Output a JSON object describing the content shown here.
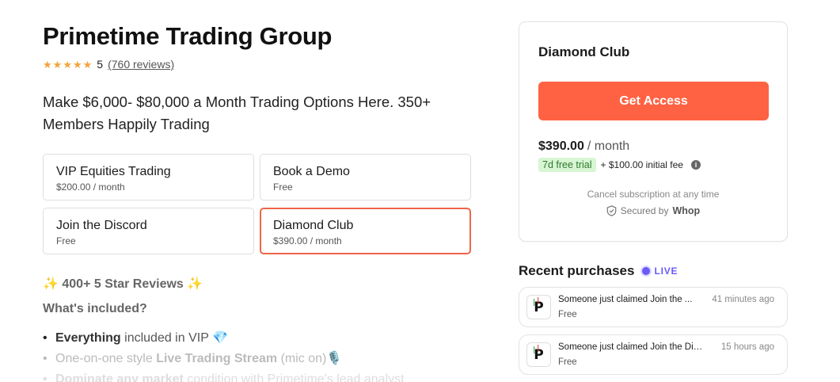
{
  "header": {
    "title": "Primetime Trading Group",
    "rating_value": "5",
    "reviews_link": "(760 reviews)",
    "star_count": 5,
    "tagline": "Make $6,000- $80,000 a Month Trading Options Here. 350+ Members Happily Trading"
  },
  "plans": [
    {
      "name": "VIP Equities Trading",
      "price": "$200.00 / month"
    },
    {
      "name": "Book a Demo",
      "price": "Free"
    },
    {
      "name": "Join the Discord",
      "price": "Free"
    },
    {
      "name": "Diamond Club",
      "price": "$390.00 / month"
    }
  ],
  "selected_plan": "Diamond Club",
  "description": {
    "highlight": "✨ 400+ 5 Star Reviews ✨",
    "included_title": "What's included?",
    "features": [
      {
        "bold": "Everything",
        "rest": " included in VIP 💎"
      },
      {
        "pre": "One-on-one style ",
        "bold": "Live Trading Stream",
        "rest": " (mic on)🎙️"
      },
      {
        "bold": "Dominate any market",
        "rest": " condition with Primetime's lead analyst"
      }
    ]
  },
  "checkout": {
    "plan_title": "Diamond Club",
    "button_label": "Get Access",
    "price": "$390.00",
    "period": "/ month",
    "trial_badge": "7d free trial",
    "initial_fee": "+ $100.00 initial fee",
    "cancel_text": "Cancel subscription at any time",
    "secured_text": "Secured by",
    "secured_brand": "Whop"
  },
  "recent": {
    "title": "Recent purchases",
    "live_label": "LIVE",
    "items": [
      {
        "text": "Someone just claimed Join the ...",
        "sub": "Free",
        "time": "41 minutes ago"
      },
      {
        "text": "Someone just claimed Join the Dis...",
        "sub": "Free",
        "time": "15 hours ago"
      }
    ]
  },
  "colors": {
    "accent": "#ff6243",
    "selected_border": "#f06548",
    "star": "#f2a43a",
    "live": "#6a5af9",
    "trial_bg": "#d8f5d4"
  }
}
